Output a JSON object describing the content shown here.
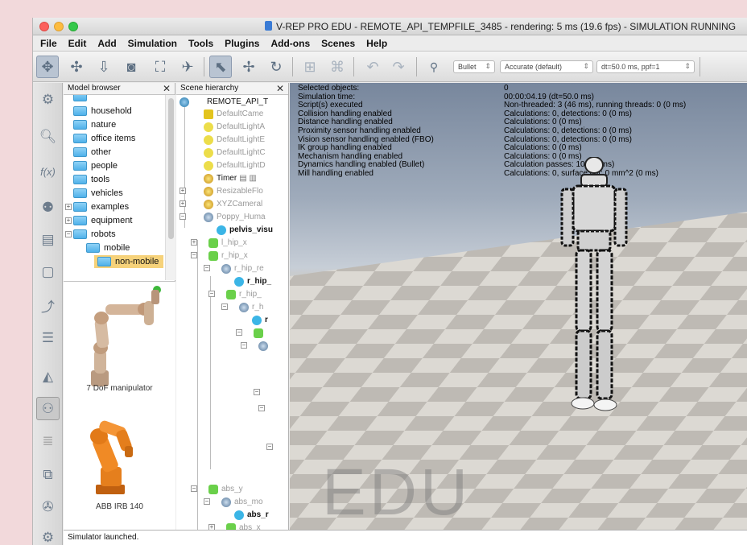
{
  "window": {
    "title": "V-REP PRO EDU - REMOTE_API_TEMPFILE_3485 - rendering: 5 ms (19.6 fps) - SIMULATION RUNNING",
    "traffic_lights": {
      "close": "#fc605c",
      "minimize": "#fdbc40",
      "zoom": "#34c84a"
    }
  },
  "menubar": [
    "File",
    "Edit",
    "Add",
    "Simulation",
    "Tools",
    "Plugins",
    "Add-ons",
    "Scenes",
    "Help"
  ],
  "toolbar": {
    "engine_combo": "Bullet",
    "accuracy_combo": "Accurate (default)",
    "timestep_combo": "dt=50.0 ms, ppf=1"
  },
  "model_browser": {
    "title": "Model browser",
    "folders": [
      {
        "label": "household",
        "level": 1
      },
      {
        "label": "nature",
        "level": 1
      },
      {
        "label": "office items",
        "level": 1
      },
      {
        "label": "other",
        "level": 1
      },
      {
        "label": "people",
        "level": 1
      },
      {
        "label": "tools",
        "level": 1
      },
      {
        "label": "vehicles",
        "level": 1
      },
      {
        "label": "examples",
        "level": 0
      },
      {
        "label": "equipment",
        "level": 0
      },
      {
        "label": "robots",
        "level": 0
      },
      {
        "label": "mobile",
        "level": 1
      },
      {
        "label": "non-mobile",
        "level": 1
      }
    ],
    "selected_folder": "non-mobile",
    "thumbnails": [
      "7 DoF manipulator",
      "ABB IRB 140"
    ]
  },
  "scene_hierarchy": {
    "title": "Scene hierarchy",
    "items": [
      {
        "label": "REMOTE_API_T",
        "style": "root"
      },
      {
        "label": "DefaultCame",
        "style": "dim"
      },
      {
        "label": "DefaultLightA",
        "style": "dim"
      },
      {
        "label": "DefaultLightE",
        "style": "dim"
      },
      {
        "label": "DefaultLightC",
        "style": "dim"
      },
      {
        "label": "DefaultLightD",
        "style": "dim"
      },
      {
        "label": "Timer",
        "style": "normal"
      },
      {
        "label": "ResizableFlo",
        "style": "dim"
      },
      {
        "label": "XYZCameral",
        "style": "dim"
      },
      {
        "label": "Poppy_Huma",
        "style": "dim"
      },
      {
        "label": "pelvis_visu",
        "style": "bold"
      },
      {
        "label": "l_hip_x",
        "style": "dim"
      },
      {
        "label": "r_hip_x",
        "style": "dim"
      },
      {
        "label": "r_hip_re",
        "style": "dim"
      },
      {
        "label": "r_hip_",
        "style": "bold"
      },
      {
        "label": "r_hip_",
        "style": "dim"
      },
      {
        "label": "r_h",
        "style": "dim"
      },
      {
        "label": "r",
        "style": "bold"
      },
      {
        "label": "abs_y",
        "style": "dim"
      },
      {
        "label": "abs_mo",
        "style": "dim"
      },
      {
        "label": "abs_r",
        "style": "bold"
      },
      {
        "label": "abs_x",
        "style": "dim"
      }
    ]
  },
  "viewport": {
    "info_labels": [
      "Selected objects:",
      "Simulation time:",
      "Script(s) executed",
      "Collision handling enabled",
      "Distance handling enabled",
      "Proximity sensor handling enabled",
      "Vision sensor handling enabled (FBO)",
      "IK group handling enabled",
      "Mechanism handling enabled",
      "Dynamics handling enabled (Bullet)",
      "Mill handling enabled"
    ],
    "info_values": [
      "0",
      "00:00:04.19 (dt=50.0 ms)",
      "Non-threaded: 3 (46 ms), running threads: 0 (0 ms)",
      "Calculations: 0, detections: 0 (0 ms)",
      "Calculations: 0 (0 ms)",
      "Calculations: 0, detections: 0 (0 ms)",
      "Calculations: 0, detections: 0 (0 ms)",
      "Calculations: 0 (0 ms)",
      "Calculations: 0 (0 ms)",
      "Calculation passes: 10 (45 ms)",
      "Calculations: 0, surface cut: 0 mm^2 (0 ms)"
    ],
    "watermark": "EDU"
  },
  "status": {
    "message": "Simulator launched."
  }
}
